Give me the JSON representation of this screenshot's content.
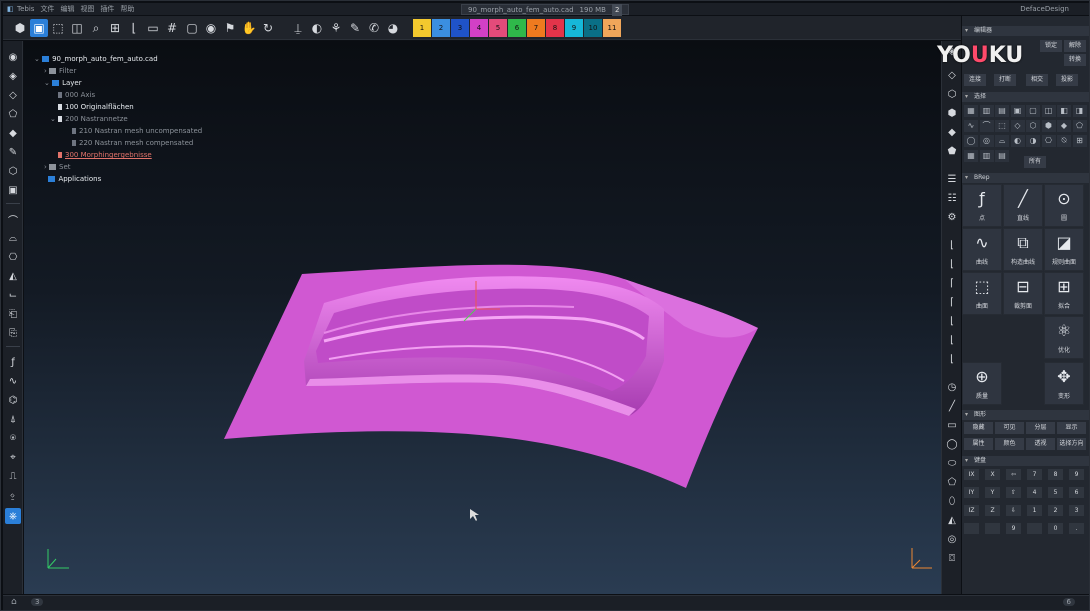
{
  "titlebar": {
    "menu": [
      "Tebis",
      "文件",
      "编辑",
      "视图",
      "插件",
      "帮助"
    ],
    "file_tab": "90_morph_auto_fem_auto.cad",
    "file_size": "190 MB",
    "tab_count": "2",
    "brand": "DefaceDesign"
  },
  "toolbar": {
    "icons": [
      "cube-icon",
      "select-icon",
      "box-icon",
      "cylinder-icon",
      "zoom-icon",
      "grid-icon",
      "axis-icon",
      "screen-icon",
      "camera-icon",
      "sphere-icon",
      "flag-icon",
      "hand-icon",
      "pin-icon",
      "rotate-icon",
      "cursor-icon",
      "shade-icon",
      "paint-icon",
      "brush-icon",
      "wrench-icon",
      "sphere-shade-icon"
    ],
    "color_layers": [
      {
        "label": "1",
        "color": "#f3c92e"
      },
      {
        "label": "2",
        "color": "#3b8fe0"
      },
      {
        "label": "3",
        "color": "#1f53c8"
      },
      {
        "label": "4",
        "color": "#d340c6"
      },
      {
        "label": "5",
        "color": "#e34b7a"
      },
      {
        "label": "6",
        "color": "#2fb84a"
      },
      {
        "label": "7",
        "color": "#ee7a1f"
      },
      {
        "label": "8",
        "color": "#e3344a"
      },
      {
        "label": "9",
        "color": "#16b8d8"
      },
      {
        "label": "10",
        "color": "#0a6f86"
      },
      {
        "label": "11",
        "color": "#f0a65a"
      }
    ]
  },
  "tree": {
    "root": "90_morph_auto_fem_auto.cad",
    "filter": "Filter",
    "layer": "Layer",
    "axis": "000 Axis",
    "original": "100 Originalflächen",
    "nastran": "200 Nastrannetze",
    "mesh_uncomp": "210 Nastran mesh uncompensated",
    "mesh_comp": "220 Nastran mesh compensated",
    "morph": "300 Morphingergebnisse",
    "set": "Set",
    "applications": "Applications"
  },
  "model": {
    "color": "#d058d2"
  },
  "watermark": {
    "a": "YO",
    "b": "U",
    "c": "KU"
  },
  "panel": {
    "editor_title": "编辑器",
    "editor_row1": [
      "锁定",
      "解除"
    ],
    "editor_row2": [
      "连接",
      "打断",
      "相交",
      "投影"
    ],
    "editor_row2b": [
      "转换"
    ],
    "select_title": "选择",
    "select_btn": "所有",
    "bigbtn_title": "BRep",
    "big_buttons": [
      {
        "icon": "ƒ",
        "label": "点"
      },
      {
        "icon": "╱",
        "label": "直线"
      },
      {
        "icon": "⊙",
        "label": "圆"
      },
      {
        "icon": "∿",
        "label": "曲线"
      },
      {
        "icon": "⧉",
        "label": "构造曲线"
      },
      {
        "icon": "◪",
        "label": "规则曲面"
      },
      {
        "icon": "⬚",
        "label": "曲面"
      },
      {
        "icon": "⊟",
        "label": "裁剪面"
      },
      {
        "icon": "⊞",
        "label": "拟合"
      },
      {
        "icon": "⚛",
        "label": "优化"
      },
      {
        "icon": "⊕",
        "label": "质量"
      },
      {
        "icon": "✥",
        "label": "变形"
      }
    ],
    "display_title": "图形",
    "display_buttons": [
      "隐藏",
      "可见",
      "分层",
      "显示",
      "属性",
      "颜色",
      "透视",
      "选择方向"
    ],
    "keypad_title": "键盘",
    "keypad": [
      "IX",
      "X",
      "⇦",
      "7",
      "8",
      "9",
      "IY",
      "Y",
      "⇧",
      "4",
      "5",
      "6",
      "IZ",
      "Z",
      "⇩",
      "1",
      "2",
      "3",
      "",
      "",
      "9",
      "",
      "0",
      "."
    ]
  },
  "status": {
    "left": "3",
    "right": "6"
  }
}
